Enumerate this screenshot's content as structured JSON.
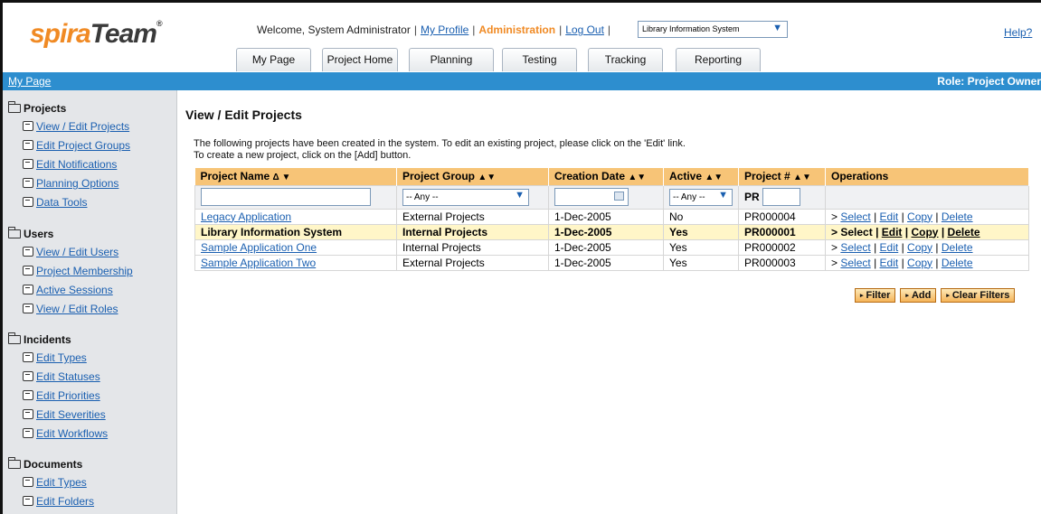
{
  "header": {
    "logo_part1": "spira",
    "logo_part2": "Team",
    "logo_reg": "®",
    "welcome": "Welcome, System Administrator",
    "my_profile": "My Profile",
    "administration": "Administration",
    "log_out": "Log Out",
    "sep": "|",
    "project_selected": "Library Information System",
    "help": "Help?"
  },
  "tabs": [
    "My Page",
    "Project Home",
    "Planning",
    "Testing",
    "Tracking",
    "Reporting"
  ],
  "bar": {
    "breadcrumb": "My Page",
    "role": "Role: Project Owner"
  },
  "sidebar": {
    "sections": [
      {
        "title": "Projects",
        "items": [
          "View / Edit Projects",
          "Edit Project Groups",
          "Edit Notifications",
          "Planning Options",
          "Data Tools"
        ]
      },
      {
        "title": "Users",
        "items": [
          "View / Edit Users",
          "Project Membership",
          "Active Sessions",
          "View / Edit Roles"
        ]
      },
      {
        "title": "Incidents",
        "items": [
          "Edit Types",
          "Edit Statuses",
          "Edit Priorities",
          "Edit Severities",
          "Edit Workflows"
        ]
      },
      {
        "title": "Documents",
        "items": [
          "Edit Types",
          "Edit Folders"
        ]
      }
    ]
  },
  "main": {
    "title": "View / Edit Projects",
    "intro_line1": "The following projects have been created in the system. To edit an existing project, please click on the 'Edit' link.",
    "intro_line2": "To create a new project, click on the [Add] button.",
    "columns": [
      {
        "label": "Project Name",
        "sort": "Δ ▼"
      },
      {
        "label": "Project Group",
        "sort": "▲▼"
      },
      {
        "label": "Creation Date",
        "sort": "▲▼"
      },
      {
        "label": "Active",
        "sort": "▲▼"
      },
      {
        "label": "Project #",
        "sort": "▲▼"
      },
      {
        "label": "Operations",
        "sort": ""
      }
    ],
    "filters": {
      "group_any": "-- Any --",
      "active_any": "-- Any --",
      "pr_prefix": "PR"
    },
    "rows": [
      {
        "name": "Legacy Application",
        "group": "External Projects",
        "date": "1-Dec-2005",
        "active": "No",
        "number": "PR000004",
        "highlight": false
      },
      {
        "name": "Library Information System",
        "group": "Internal Projects",
        "date": "1-Dec-2005",
        "active": "Yes",
        "number": "PR000001",
        "highlight": true
      },
      {
        "name": "Sample Application One",
        "group": "Internal Projects",
        "date": "1-Dec-2005",
        "active": "Yes",
        "number": "PR000002",
        "highlight": false
      },
      {
        "name": "Sample Application Two",
        "group": "External Projects",
        "date": "1-Dec-2005",
        "active": "Yes",
        "number": "PR000003",
        "highlight": false
      }
    ],
    "operations": {
      "prefix": ">",
      "select": "Select",
      "edit": "Edit",
      "copy": "Copy",
      "delete": "Delete",
      "sep": "|"
    },
    "buttons": {
      "filter": "Filter",
      "add": "Add",
      "clear": "Clear Filters",
      "tri": "▸"
    }
  },
  "colors": {
    "accent_orange": "#f08a24",
    "bar_blue": "#2d8ecf",
    "header_orange": "#f7c477",
    "highlight_row": "#fff6c8",
    "link_blue": "#1a5fb0"
  },
  "icons": {
    "folder": "folder-open-icon",
    "item": "page-edit-icon",
    "dropdown": "dropdown-arrow-icon",
    "calendar": "calendar-icon"
  }
}
